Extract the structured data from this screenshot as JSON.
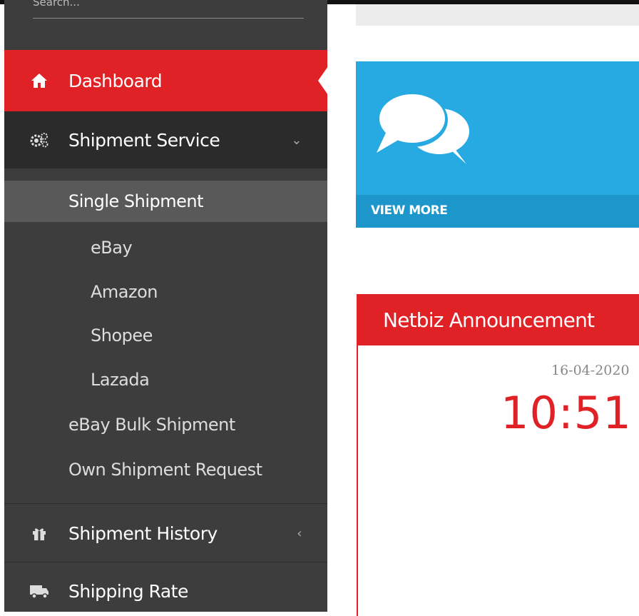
{
  "sidebar": {
    "search_placeholder": "Search...",
    "items": {
      "dashboard": "Dashboard",
      "shipment_service": "Shipment Service",
      "shipment_history": "Shipment History",
      "shipping_rate": "Shipping Rate"
    },
    "submenu": {
      "single_shipment": "Single Shipment",
      "ebay": "eBay",
      "amazon": "Amazon",
      "shopee": "Shopee",
      "lazada": "Lazada",
      "ebay_bulk": "eBay Bulk Shipment",
      "own_request": "Own Shipment Request"
    },
    "chevron_open": "⌄",
    "chevron_closed": "‹"
  },
  "main": {
    "tile": {
      "footer_label": "VIEW MORE",
      "icon": "comments-icon"
    },
    "announcement": {
      "title": "Netbiz Announcement",
      "date": "16-04-2020",
      "time": "10:51"
    }
  },
  "colors": {
    "accent_red": "#e02126",
    "sidebar_bg": "#3d3d3d",
    "tile_blue": "#27a9e1"
  }
}
